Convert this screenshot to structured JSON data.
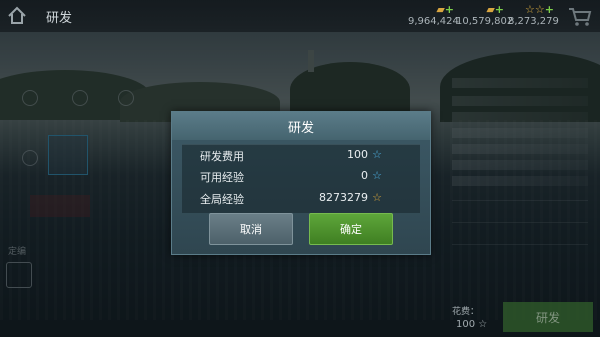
{
  "topbar": {
    "title": "研发",
    "resources": [
      {
        "icon": "gold-bar-icon",
        "value": "9,964,424"
      },
      {
        "icon": "gold-bar-icon",
        "value": "10,579,802"
      },
      {
        "icon": "star-icon",
        "value": "8,273,279"
      }
    ]
  },
  "left_panel": {
    "label": "定编"
  },
  "bottom": {
    "cost_label": "花费：",
    "cost_value": "100 ☆",
    "research_button": "研发"
  },
  "dialog": {
    "title": "研发",
    "rows": [
      {
        "label": "研发费用",
        "value": "100",
        "star": "blue"
      },
      {
        "label": "可用经验",
        "value": "0",
        "star": "blue"
      },
      {
        "label": "全局经验",
        "value": "8273279",
        "star": "gold"
      }
    ],
    "cancel_label": "取消",
    "confirm_label": "确定"
  },
  "colors": {
    "confirm_green": "#3f7f22",
    "dialog_header": "#5b7c89",
    "star_blue": "#4eb4e8",
    "star_gold": "#e0a93a"
  }
}
